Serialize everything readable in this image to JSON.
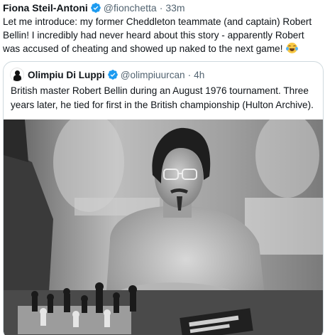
{
  "tweet": {
    "author_name": "Fiona Steil-Antoni",
    "author_handle": "@fionchetta",
    "separator": "·",
    "time": "33m",
    "text": "Let me introduce: my former Cheddleton teammate (and captain) Robert Bellin! I incredibly had never heard about this story - apparently Robert was accused of cheating and showed up naked to the next game!",
    "emoji": "face-with-tears-of-joy"
  },
  "quoted_tweet": {
    "author_name": "Olimpiu Di Luppi",
    "author_handle": "@olimpiuurcan",
    "separator": "·",
    "time": "4h",
    "text": "British master Robert Bellin during an August 1976 tournament. Three years later, he tied for first in the British championship (Hulton Archive).",
    "photo_description_icon": "black-and-white-photo"
  },
  "colors": {
    "verified_blue": "#1d9bf0",
    "secondary_text": "#536471",
    "border": "#cfd9de"
  }
}
